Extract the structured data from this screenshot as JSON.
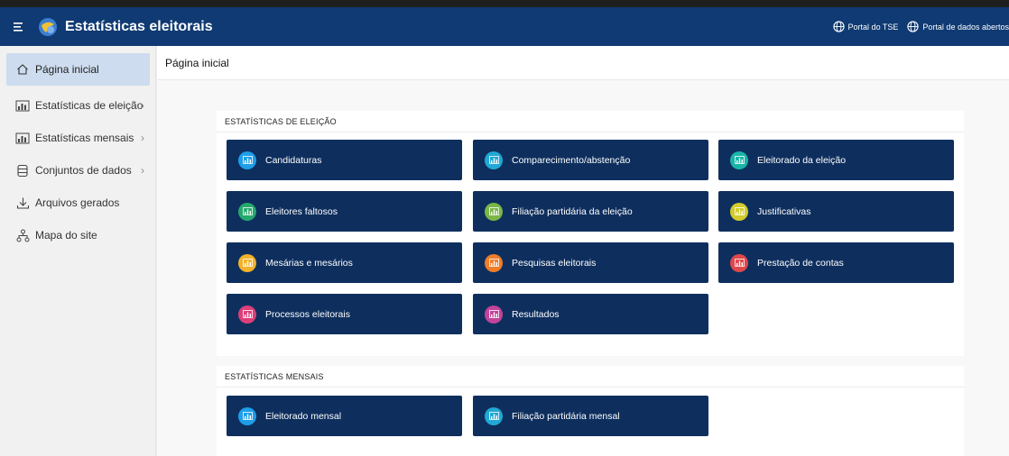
{
  "header": {
    "title": "Estatísticas eleitorais",
    "links": [
      "Portal do TSE",
      "Portal de dados abertos"
    ]
  },
  "sidebar": {
    "items": [
      {
        "label": "Página inicial",
        "icon": "home-icon"
      },
      {
        "label": "Estatísticas de eleição",
        "icon": "chart-icon"
      },
      {
        "label": "Estatísticas mensais",
        "icon": "chart-icon"
      },
      {
        "label": "Conjuntos de dados",
        "icon": "database-icon"
      },
      {
        "label": "Arquivos gerados",
        "icon": "download-icon"
      },
      {
        "label": "Mapa do site",
        "icon": "sitemap-icon"
      }
    ]
  },
  "breadcrumb": "Página inicial",
  "sections": {
    "eleicao": {
      "title": "ESTATÍSTICAS DE ELEIÇÃO",
      "cards": [
        {
          "label": "Candidaturas",
          "color": "#1e9ee8"
        },
        {
          "label": "Comparecimento/abstenção",
          "color": "#21a8d4"
        },
        {
          "label": "Eleitorado da eleição",
          "color": "#19b5a8"
        },
        {
          "label": "Eleitores faltosos",
          "color": "#26a86e"
        },
        {
          "label": "Filiação partidária da eleição",
          "color": "#7ab648"
        },
        {
          "label": "Justificativas",
          "color": "#d3cc2a"
        },
        {
          "label": "Mesárias e mesários",
          "color": "#f2b22a"
        },
        {
          "label": "Pesquisas eleitorais",
          "color": "#ef7d2a"
        },
        {
          "label": "Prestação de contas",
          "color": "#e0474a"
        },
        {
          "label": "Processos eleitorais",
          "color": "#dd3f78"
        },
        {
          "label": "Resultados",
          "color": "#c2449a"
        }
      ]
    },
    "mensais": {
      "title": "ESTATÍSTICAS MENSAIS",
      "cards": [
        {
          "label": "Eleitorado mensal",
          "color": "#1e9ee8"
        },
        {
          "label": "Filiação partidária mensal",
          "color": "#21a8d4"
        }
      ]
    }
  }
}
